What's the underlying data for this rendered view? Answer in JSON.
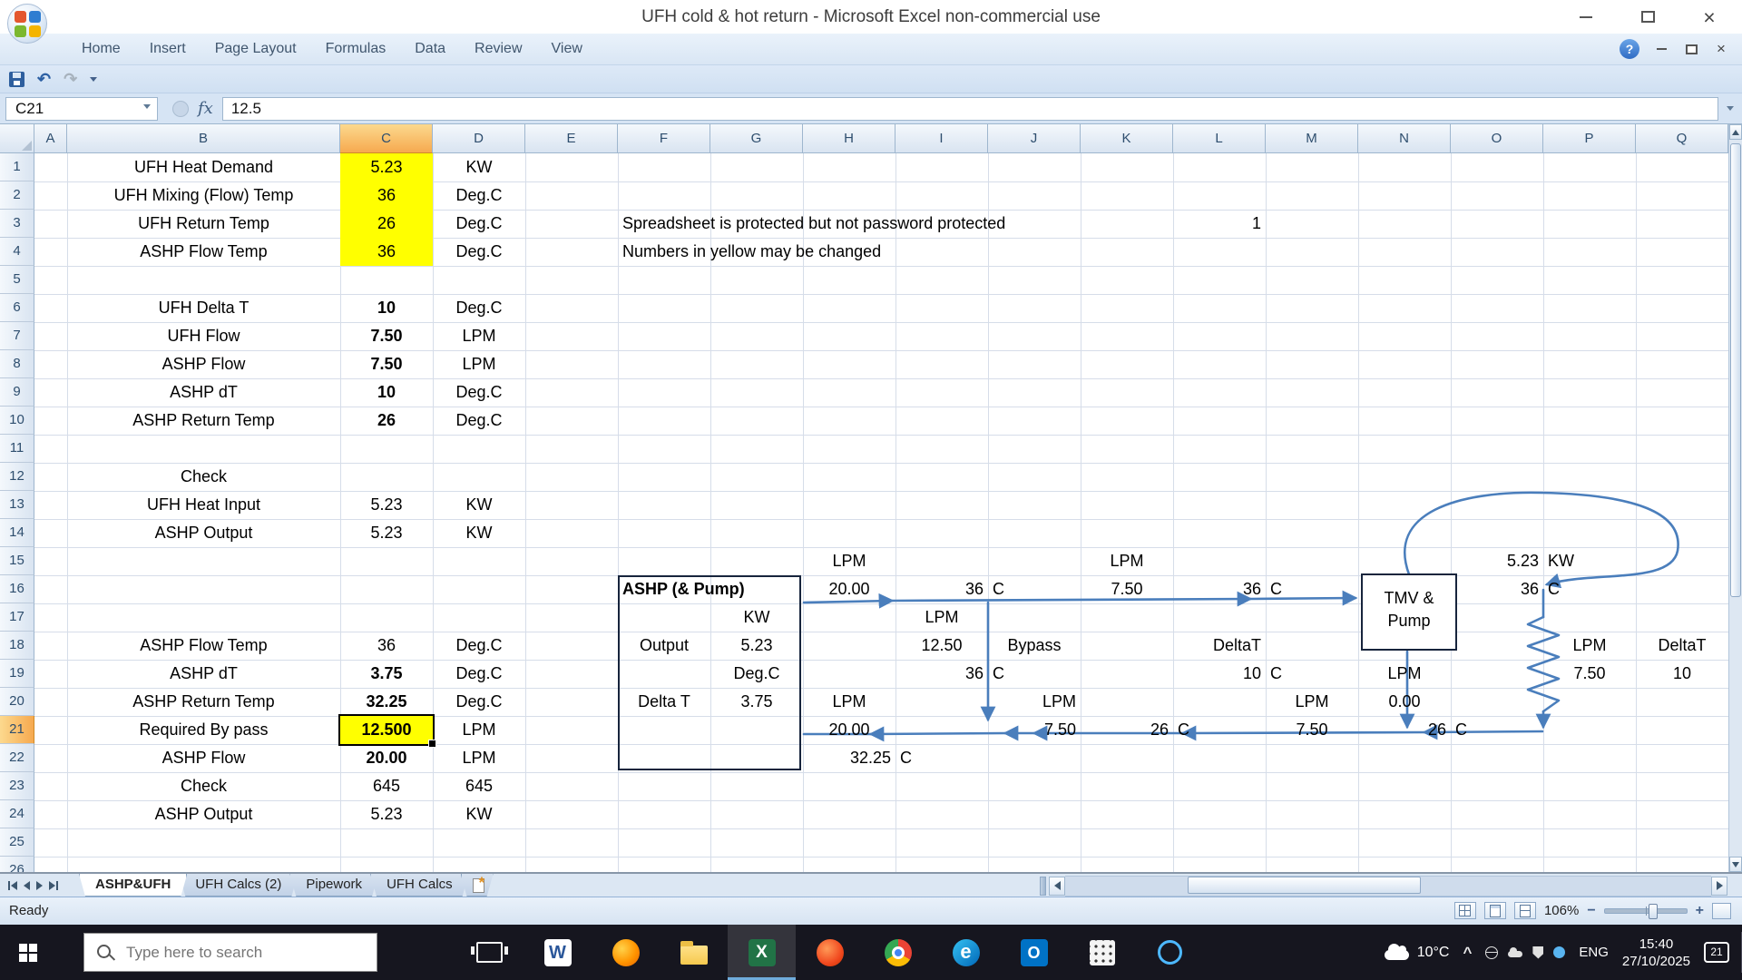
{
  "window": {
    "title": "UFH cold & hot return - Microsoft Excel non-commercial use"
  },
  "ribbon": {
    "tabs": [
      "Home",
      "Insert",
      "Page Layout",
      "Formulas",
      "Data",
      "Review",
      "View"
    ]
  },
  "quick_access": {
    "icons": [
      "save",
      "undo",
      "redo",
      "customize-menu"
    ]
  },
  "formula_bar": {
    "name_box": "C21",
    "fx": "fx",
    "value": "12.5"
  },
  "sheet": {
    "columns": [
      "A",
      "B",
      "C",
      "D",
      "E",
      "F",
      "G",
      "H",
      "I",
      "J",
      "K",
      "L",
      "M",
      "N",
      "O",
      "P",
      "Q"
    ],
    "visible_rows": 26,
    "selection": {
      "col": "C",
      "row": 21
    },
    "cells": [
      {
        "ref": "B1",
        "t": "UFH Heat Demand"
      },
      {
        "ref": "C1",
        "t": "5.23",
        "y": 1
      },
      {
        "ref": "D1",
        "t": "KW"
      },
      {
        "ref": "B2",
        "t": "UFH Mixing (Flow) Temp"
      },
      {
        "ref": "C2",
        "t": "36",
        "y": 1
      },
      {
        "ref": "D2",
        "t": "Deg.C"
      },
      {
        "ref": "B3",
        "t": "UFH Return Temp"
      },
      {
        "ref": "C3",
        "t": "26",
        "y": 1
      },
      {
        "ref": "D3",
        "t": "Deg.C"
      },
      {
        "ref": "F3",
        "t": "Spreadsheet is protected but not password protected",
        "a": "l"
      },
      {
        "ref": "L3",
        "t": "1",
        "a": "r"
      },
      {
        "ref": "B4",
        "t": "ASHP Flow Temp"
      },
      {
        "ref": "C4",
        "t": "36",
        "y": 1
      },
      {
        "ref": "D4",
        "t": "Deg.C"
      },
      {
        "ref": "F4",
        "t": "Numbers in yellow may be changed",
        "a": "l"
      },
      {
        "ref": "B6",
        "t": "UFH Delta T"
      },
      {
        "ref": "C6",
        "t": "10",
        "b": 1
      },
      {
        "ref": "D6",
        "t": "Deg.C"
      },
      {
        "ref": "B7",
        "t": "UFH Flow"
      },
      {
        "ref": "C7",
        "t": "7.50",
        "b": 1
      },
      {
        "ref": "D7",
        "t": "LPM"
      },
      {
        "ref": "B8",
        "t": "ASHP Flow"
      },
      {
        "ref": "C8",
        "t": "7.50",
        "b": 1
      },
      {
        "ref": "D8",
        "t": "LPM"
      },
      {
        "ref": "B9",
        "t": "ASHP dT"
      },
      {
        "ref": "C9",
        "t": "10",
        "b": 1
      },
      {
        "ref": "D9",
        "t": "Deg.C"
      },
      {
        "ref": "B10",
        "t": "ASHP Return Temp"
      },
      {
        "ref": "C10",
        "t": "26",
        "b": 1
      },
      {
        "ref": "D10",
        "t": "Deg.C"
      },
      {
        "ref": "B12",
        "t": "Check"
      },
      {
        "ref": "B13",
        "t": "UFH Heat Input"
      },
      {
        "ref": "C13",
        "t": "5.23"
      },
      {
        "ref": "D13",
        "t": "KW"
      },
      {
        "ref": "B14",
        "t": "ASHP Output"
      },
      {
        "ref": "C14",
        "t": "5.23"
      },
      {
        "ref": "D14",
        "t": "KW"
      },
      {
        "ref": "H15",
        "t": "LPM"
      },
      {
        "ref": "K15",
        "t": "LPM"
      },
      {
        "ref": "O15",
        "t": "5.23",
        "a": "r"
      },
      {
        "ref": "P15",
        "t": "KW",
        "a": "l"
      },
      {
        "ref": "F16",
        "t": "ASHP (& Pump)",
        "a": "l",
        "b": 1
      },
      {
        "ref": "H16",
        "t": "20.00"
      },
      {
        "ref": "I16",
        "t": "36",
        "a": "r"
      },
      {
        "ref": "J16",
        "t": "C",
        "a": "l"
      },
      {
        "ref": "K16",
        "t": "7.50"
      },
      {
        "ref": "L16",
        "t": "36",
        "a": "r"
      },
      {
        "ref": "M16",
        "t": "C",
        "a": "l"
      },
      {
        "ref": "O16",
        "t": "36",
        "a": "r"
      },
      {
        "ref": "P16",
        "t": "C",
        "a": "l"
      },
      {
        "ref": "G17",
        "t": "KW"
      },
      {
        "ref": "I17",
        "t": "LPM"
      },
      {
        "ref": "B18",
        "t": "ASHP Flow Temp"
      },
      {
        "ref": "C18",
        "t": "36"
      },
      {
        "ref": "D18",
        "t": "Deg.C"
      },
      {
        "ref": "F18",
        "t": "Output"
      },
      {
        "ref": "G18",
        "t": "5.23"
      },
      {
        "ref": "I18",
        "t": "12.50"
      },
      {
        "ref": "J18",
        "t": "Bypass"
      },
      {
        "ref": "L18",
        "t": "DeltaT",
        "a": "r"
      },
      {
        "ref": "P18",
        "t": "LPM"
      },
      {
        "ref": "Q18",
        "t": "DeltaT"
      },
      {
        "ref": "B19",
        "t": "ASHP dT"
      },
      {
        "ref": "C19",
        "t": "3.75",
        "b": 1
      },
      {
        "ref": "D19",
        "t": "Deg.C"
      },
      {
        "ref": "G19",
        "t": "Deg.C"
      },
      {
        "ref": "I19",
        "t": "36",
        "a": "r"
      },
      {
        "ref": "J19",
        "t": "C",
        "a": "l"
      },
      {
        "ref": "L19",
        "t": "10",
        "a": "r"
      },
      {
        "ref": "M19",
        "t": "C",
        "a": "l"
      },
      {
        "ref": "N19",
        "t": "LPM"
      },
      {
        "ref": "P19",
        "t": "7.50"
      },
      {
        "ref": "Q19",
        "t": "10"
      },
      {
        "ref": "B20",
        "t": "ASHP Return Temp"
      },
      {
        "ref": "C20",
        "t": "32.25",
        "b": 1
      },
      {
        "ref": "D20",
        "t": "Deg.C"
      },
      {
        "ref": "F20",
        "t": "Delta T"
      },
      {
        "ref": "G20",
        "t": "3.75"
      },
      {
        "ref": "H20",
        "t": "LPM"
      },
      {
        "ref": "J20",
        "t": "LPM",
        "a": "r"
      },
      {
        "ref": "M20",
        "t": "LPM"
      },
      {
        "ref": "N20",
        "t": "0.00"
      },
      {
        "ref": "B21",
        "t": "Required By pass"
      },
      {
        "ref": "C21",
        "t": "12.500",
        "b": 1,
        "y": 1,
        "sel": 1
      },
      {
        "ref": "D21",
        "t": "LPM"
      },
      {
        "ref": "H21",
        "t": "20.00"
      },
      {
        "ref": "J21",
        "t": "7.50",
        "a": "r"
      },
      {
        "ref": "K21",
        "t": "26",
        "a": "r"
      },
      {
        "ref": "L21",
        "t": "C",
        "a": "l"
      },
      {
        "ref": "M21",
        "t": "7.50"
      },
      {
        "ref": "N21",
        "t": "26",
        "a": "r"
      },
      {
        "ref": "O21",
        "t": "C",
        "a": "l"
      },
      {
        "ref": "B22",
        "t": "ASHP Flow"
      },
      {
        "ref": "C22",
        "t": "20.00",
        "b": 1
      },
      {
        "ref": "D22",
        "t": "LPM"
      },
      {
        "ref": "H22",
        "t": "32.25",
        "a": "r"
      },
      {
        "ref": "I22",
        "t": "C",
        "a": "l"
      },
      {
        "ref": "B23",
        "t": "Check"
      },
      {
        "ref": "C23",
        "t": "645"
      },
      {
        "ref": "D23",
        "t": "645"
      },
      {
        "ref": "B24",
        "t": "ASHP Output"
      },
      {
        "ref": "C24",
        "t": "5.23"
      },
      {
        "ref": "D24",
        "t": "KW"
      }
    ]
  },
  "diagram": {
    "tmv_line1": "TMV &",
    "tmv_line2": "Pump",
    "ink_color": "#4a7ebc"
  },
  "sheet_tabs": {
    "tabs": [
      {
        "label": "ASHP&UFH",
        "active": true
      },
      {
        "label": "UFH Calcs (2)",
        "active": false
      },
      {
        "label": "Pipework",
        "active": false
      },
      {
        "label": "UFH Calcs",
        "active": false
      }
    ]
  },
  "status_bar": {
    "ready": "Ready",
    "zoom": "106%"
  },
  "taskbar": {
    "search_placeholder": "Type here to search",
    "icons": [
      {
        "name": "task-view",
        "glyph": "",
        "active": false
      },
      {
        "name": "word",
        "glyph": "W",
        "active": false
      },
      {
        "name": "firefox",
        "glyph": "",
        "active": false
      },
      {
        "name": "file-explorer",
        "glyph": "",
        "active": false
      },
      {
        "name": "excel",
        "glyph": "X",
        "active": true
      },
      {
        "name": "browser-2",
        "glyph": "",
        "active": false
      },
      {
        "name": "chrome",
        "glyph": "",
        "active": false
      },
      {
        "name": "edge",
        "glyph": "e",
        "active": false
      },
      {
        "name": "outlook",
        "glyph": "O",
        "active": false
      },
      {
        "name": "app-grid",
        "glyph": "",
        "active": false
      },
      {
        "name": "cortana",
        "glyph": "",
        "active": false
      }
    ],
    "tray": {
      "weather": "10°C",
      "lang": "ENG",
      "time": "15:40",
      "date": "27/10/2025",
      "badge": "21"
    }
  }
}
